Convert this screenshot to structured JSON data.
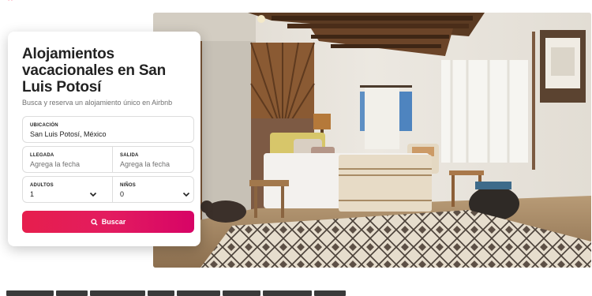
{
  "brand": {
    "name": "airbnb",
    "logo_icon": "airbnb-belo-icon",
    "accent": "#ff385c"
  },
  "search_card": {
    "title": "Alojamientos vacacionales en San Luis Potosí",
    "subtitle": "Busca y reserva un alojamiento único en Airbnb",
    "location": {
      "label": "UBICACIÓN",
      "value": "San Luis Potosí, México"
    },
    "checkin": {
      "label": "LLEGADA",
      "placeholder": "Agrega la fecha"
    },
    "checkout": {
      "label": "SALIDA",
      "placeholder": "Agrega la fecha"
    },
    "adults": {
      "label": "ADULTOS",
      "value": "1"
    },
    "children": {
      "label": "NIÑOS",
      "value": "0"
    },
    "search_button": {
      "label": "Buscar",
      "icon": "search-icon",
      "color": "#e31c5f"
    }
  },
  "hero": {
    "image_icon": "bedroom-photo"
  }
}
